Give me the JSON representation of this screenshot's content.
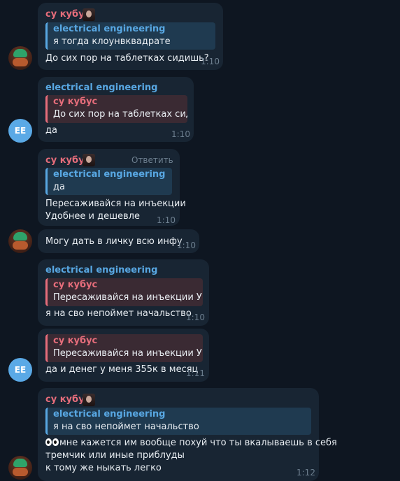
{
  "messages": [
    {
      "author": "су кубус",
      "reply": {
        "author": "electrical engineering",
        "text": "я тогда клоунвквадрате"
      },
      "lines": [
        "До сих пор на таблетках сидишь?"
      ],
      "time": "1:10"
    },
    {
      "author": "electrical engineering",
      "avatar_initials": "EE",
      "reply": {
        "author": "су кубус",
        "text": "До сих пор на таблетках сид..."
      },
      "lines": [
        "да"
      ],
      "time": "1:10"
    },
    {
      "author": "су кубус",
      "reply_action": "Ответить",
      "reply": {
        "author": "electrical engineering",
        "text": "да"
      },
      "lines": [
        "Пересаживайся на инъекции",
        "Удобнее и дешевле"
      ],
      "time": "1:10"
    },
    {
      "lines": [
        "Могу дать в личку всю инфу"
      ],
      "time": "1:10"
    },
    {
      "author": "electrical engineering",
      "reply": {
        "author": "су кубус",
        "text": "Пересаживайся на инъекции У..."
      },
      "lines": [
        "я на сво непоймет начальство"
      ],
      "time": "1:10"
    },
    {
      "avatar_initials": "EE",
      "reply": {
        "author": "су кубус",
        "text": "Пересаживайся на инъекции У..."
      },
      "lines": [
        "да и денег у меня 355к в месяц"
      ],
      "time": "1:11"
    },
    {
      "author": "су кубус",
      "reply": {
        "author": "electrical engineering",
        "text": "я на сво непоймет начальство"
      },
      "lines": [
        "мне кажется им вообще похуй что ты вкалываешь в себя",
        "тремчик или иные приблуды",
        "к тому же ныкать легко"
      ],
      "time": "1:12"
    }
  ]
}
